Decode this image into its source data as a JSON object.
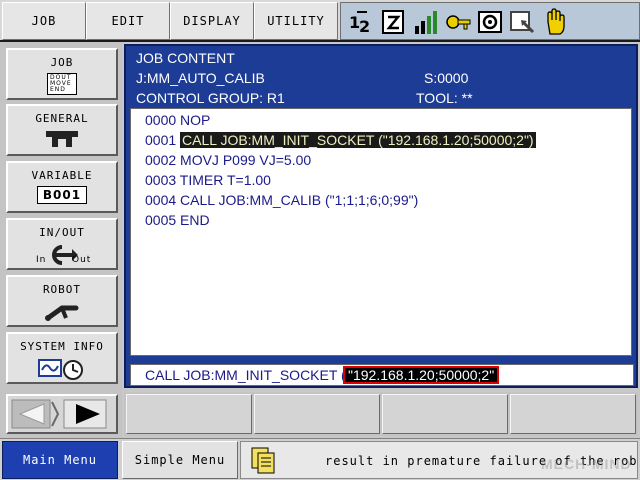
{
  "top_menu": {
    "items": [
      "JOB",
      "EDIT",
      "DISPLAY",
      "UTILITY"
    ]
  },
  "side_menu": {
    "job": {
      "label": "JOB",
      "icon_lines": [
        "DOUT",
        "MOVE",
        "END"
      ]
    },
    "general": {
      "label": "GENERAL"
    },
    "variable": {
      "label": "VARIABLE",
      "value": "B001"
    },
    "inout": {
      "label": "IN/OUT",
      "in": "In",
      "out": "Out"
    },
    "robot": {
      "label": "ROBOT"
    },
    "system_info": {
      "label": "SYSTEM INFO"
    }
  },
  "content": {
    "title": "JOB CONTENT",
    "job_name": "J:MM_AUTO_CALIB",
    "step": "S:0000",
    "control_group": "CONTROL GROUP: R1",
    "tool": "TOOL: **",
    "lines": [
      {
        "num": "0000",
        "text": "NOP",
        "selected": false
      },
      {
        "num": "0001",
        "text": "CALL JOB:MM_INIT_SOCKET (\"192.168.1.20;50000;2\")",
        "selected": true
      },
      {
        "num": "0002",
        "text": "MOVJ P099 VJ=5.00",
        "selected": false
      },
      {
        "num": "0003",
        "text": "TIMER T=1.00",
        "selected": false
      },
      {
        "num": "0004",
        "text": "CALL JOB:MM_CALIB (\"1;1;1;6;0;99\")",
        "selected": false
      },
      {
        "num": "0005",
        "text": "END",
        "selected": false
      }
    ],
    "edit_line": {
      "prefix": "CALL JOB:MM_INIT_SOCKET (",
      "selected_arg": "\"192.168.1.20;50000;2\""
    }
  },
  "bottom": {
    "main_menu": "Main Menu",
    "simple_menu": "Simple Menu",
    "message": "result in premature failure of the robot. Se",
    "watermark": "MECH-MIND"
  },
  "colors": {
    "accent_blue": "#1d3c96",
    "main_menu_blue": "#1e3fb0",
    "highlight_red": "#e00000"
  }
}
